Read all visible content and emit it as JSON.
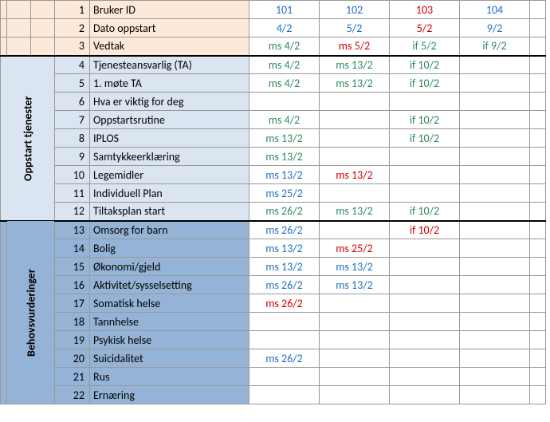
{
  "sections": {
    "mid_label": "Oppstart tjenester",
    "bot_label": "Behovsvurderinger"
  },
  "rows": [
    {
      "sec": "top",
      "num": "1",
      "label": "Bruker ID",
      "cells": [
        {
          "v": "101",
          "c": "blue"
        },
        {
          "v": "102",
          "c": "blue"
        },
        {
          "v": "103",
          "c": "red"
        },
        {
          "v": "104",
          "c": "blue"
        }
      ]
    },
    {
      "sec": "top",
      "num": "2",
      "label": "Dato oppstart",
      "cells": [
        {
          "v": "4/2",
          "c": "blue"
        },
        {
          "v": "5/2",
          "c": "blue"
        },
        {
          "v": "5/2",
          "c": "red"
        },
        {
          "v": "9/2",
          "c": "blue"
        }
      ]
    },
    {
      "sec": "top",
      "num": "3",
      "label": "Vedtak",
      "cells": [
        {
          "v": "ms 4/2",
          "c": "green"
        },
        {
          "v": "ms 5/2",
          "c": "red"
        },
        {
          "v": "if 5/2",
          "c": "green"
        },
        {
          "v": "if 9/2",
          "c": "green"
        }
      ]
    },
    {
      "sec": "mid",
      "num": "4",
      "label": "Tjenesteansvarlig (TA)",
      "cells": [
        {
          "v": "ms 4/2",
          "c": "green"
        },
        {
          "v": "ms 13/2",
          "c": "green"
        },
        {
          "v": "if 10/2",
          "c": "green"
        },
        {
          "v": ""
        }
      ]
    },
    {
      "sec": "mid",
      "num": "5",
      "label": "1. møte TA",
      "cells": [
        {
          "v": "ms 4/2",
          "c": "green"
        },
        {
          "v": "ms 13/2",
          "c": "green"
        },
        {
          "v": "if 10/2",
          "c": "green"
        },
        {
          "v": ""
        }
      ]
    },
    {
      "sec": "mid",
      "num": "6",
      "label": "Hva er viktig for deg",
      "cells": [
        {
          "v": ""
        },
        {
          "v": ""
        },
        {
          "v": ""
        },
        {
          "v": ""
        }
      ]
    },
    {
      "sec": "mid",
      "num": "7",
      "label": "Oppstartsrutine",
      "cells": [
        {
          "v": "ms 4/2",
          "c": "green"
        },
        {
          "v": ""
        },
        {
          "v": "if 10/2",
          "c": "green"
        },
        {
          "v": ""
        }
      ]
    },
    {
      "sec": "mid",
      "num": "8",
      "label": "IPLOS",
      "cells": [
        {
          "v": "ms 13/2",
          "c": "green"
        },
        {
          "v": ""
        },
        {
          "v": "if 10/2",
          "c": "green"
        },
        {
          "v": ""
        }
      ]
    },
    {
      "sec": "mid",
      "num": "9",
      "label": "Samtykkeerklæring",
      "cells": [
        {
          "v": "ms 13/2",
          "c": "green"
        },
        {
          "v": ""
        },
        {
          "v": ""
        },
        {
          "v": ""
        }
      ]
    },
    {
      "sec": "mid",
      "num": "10",
      "label": "Legemidler",
      "cells": [
        {
          "v": "ms 13/2",
          "c": "blue"
        },
        {
          "v": "ms 13/2",
          "c": "red"
        },
        {
          "v": ""
        },
        {
          "v": ""
        }
      ]
    },
    {
      "sec": "mid",
      "num": "11",
      "label": "Individuell Plan",
      "cells": [
        {
          "v": "ms 25/2",
          "c": "blue"
        },
        {
          "v": ""
        },
        {
          "v": ""
        },
        {
          "v": ""
        }
      ]
    },
    {
      "sec": "mid",
      "num": "12",
      "label": "Tiltaksplan start",
      "cells": [
        {
          "v": "ms 26/2",
          "c": "green"
        },
        {
          "v": "ms 13/2",
          "c": "green"
        },
        {
          "v": "if 10/2",
          "c": "green"
        },
        {
          "v": ""
        }
      ]
    },
    {
      "sec": "bot",
      "num": "13",
      "label": "Omsorg for barn",
      "cells": [
        {
          "v": "ms 26/2",
          "c": "blue"
        },
        {
          "v": ""
        },
        {
          "v": "if 10/2",
          "c": "red"
        },
        {
          "v": ""
        }
      ]
    },
    {
      "sec": "bot",
      "num": "14",
      "label": "Bolig",
      "cells": [
        {
          "v": "ms 13/2",
          "c": "blue"
        },
        {
          "v": "ms 25/2",
          "c": "red"
        },
        {
          "v": ""
        },
        {
          "v": ""
        }
      ]
    },
    {
      "sec": "bot",
      "num": "15",
      "label": "Økonomi/gjeld",
      "cells": [
        {
          "v": "ms 13/2",
          "c": "blue"
        },
        {
          "v": "ms 13/2",
          "c": "blue"
        },
        {
          "v": ""
        },
        {
          "v": ""
        }
      ]
    },
    {
      "sec": "bot",
      "num": "16",
      "label": "Aktivitet/sysselsetting",
      "cells": [
        {
          "v": "ms 26/2",
          "c": "blue"
        },
        {
          "v": "ms 13/2",
          "c": "blue"
        },
        {
          "v": ""
        },
        {
          "v": ""
        }
      ]
    },
    {
      "sec": "bot",
      "num": "17",
      "label": "Somatisk helse",
      "cells": [
        {
          "v": "ms 26/2",
          "c": "red"
        },
        {
          "v": ""
        },
        {
          "v": ""
        },
        {
          "v": ""
        }
      ]
    },
    {
      "sec": "bot",
      "num": "18",
      "label": "Tannhelse",
      "cells": [
        {
          "v": ""
        },
        {
          "v": ""
        },
        {
          "v": ""
        },
        {
          "v": ""
        }
      ]
    },
    {
      "sec": "bot",
      "num": "19",
      "label": "Psykisk helse",
      "cells": [
        {
          "v": ""
        },
        {
          "v": ""
        },
        {
          "v": ""
        },
        {
          "v": ""
        }
      ]
    },
    {
      "sec": "bot",
      "num": "20",
      "label": "Suicidalitet",
      "cells": [
        {
          "v": "ms 26/2",
          "c": "blue"
        },
        {
          "v": ""
        },
        {
          "v": ""
        },
        {
          "v": ""
        }
      ]
    },
    {
      "sec": "bot",
      "num": "21",
      "label": "Rus",
      "cells": [
        {
          "v": ""
        },
        {
          "v": ""
        },
        {
          "v": ""
        },
        {
          "v": ""
        }
      ]
    },
    {
      "sec": "bot",
      "num": "22",
      "label": "Ernæring",
      "cells": [
        {
          "v": ""
        },
        {
          "v": ""
        },
        {
          "v": ""
        },
        {
          "v": ""
        }
      ]
    }
  ]
}
